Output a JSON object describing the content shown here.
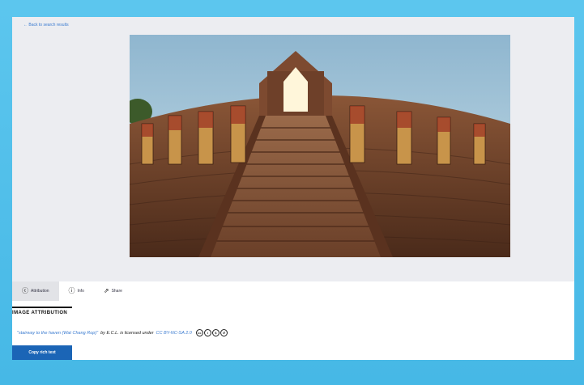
{
  "nav": {
    "back_label": "← Back to search results"
  },
  "image": {
    "alt": "Temple staircase photo"
  },
  "tabs": [
    {
      "label": "Attribution",
      "icon": "attribution-icon"
    },
    {
      "label": "Info",
      "icon": "info-icon"
    },
    {
      "label": "Share",
      "icon": "share-icon"
    }
  ],
  "attribution": {
    "heading": "IMAGE ATTRIBUTION",
    "title": "\"stairway to the haven (Wat Chang Rop)\"",
    "by_text": "by E.C.L. is licensed under",
    "license": "CC BY-NC-SA 2.0",
    "copy_button": "Copy rich text"
  },
  "colors": {
    "frame": "#4fc0ea",
    "link": "#3b7bd0",
    "button": "#1b65b6",
    "viewer_bg": "#ecedf1"
  }
}
